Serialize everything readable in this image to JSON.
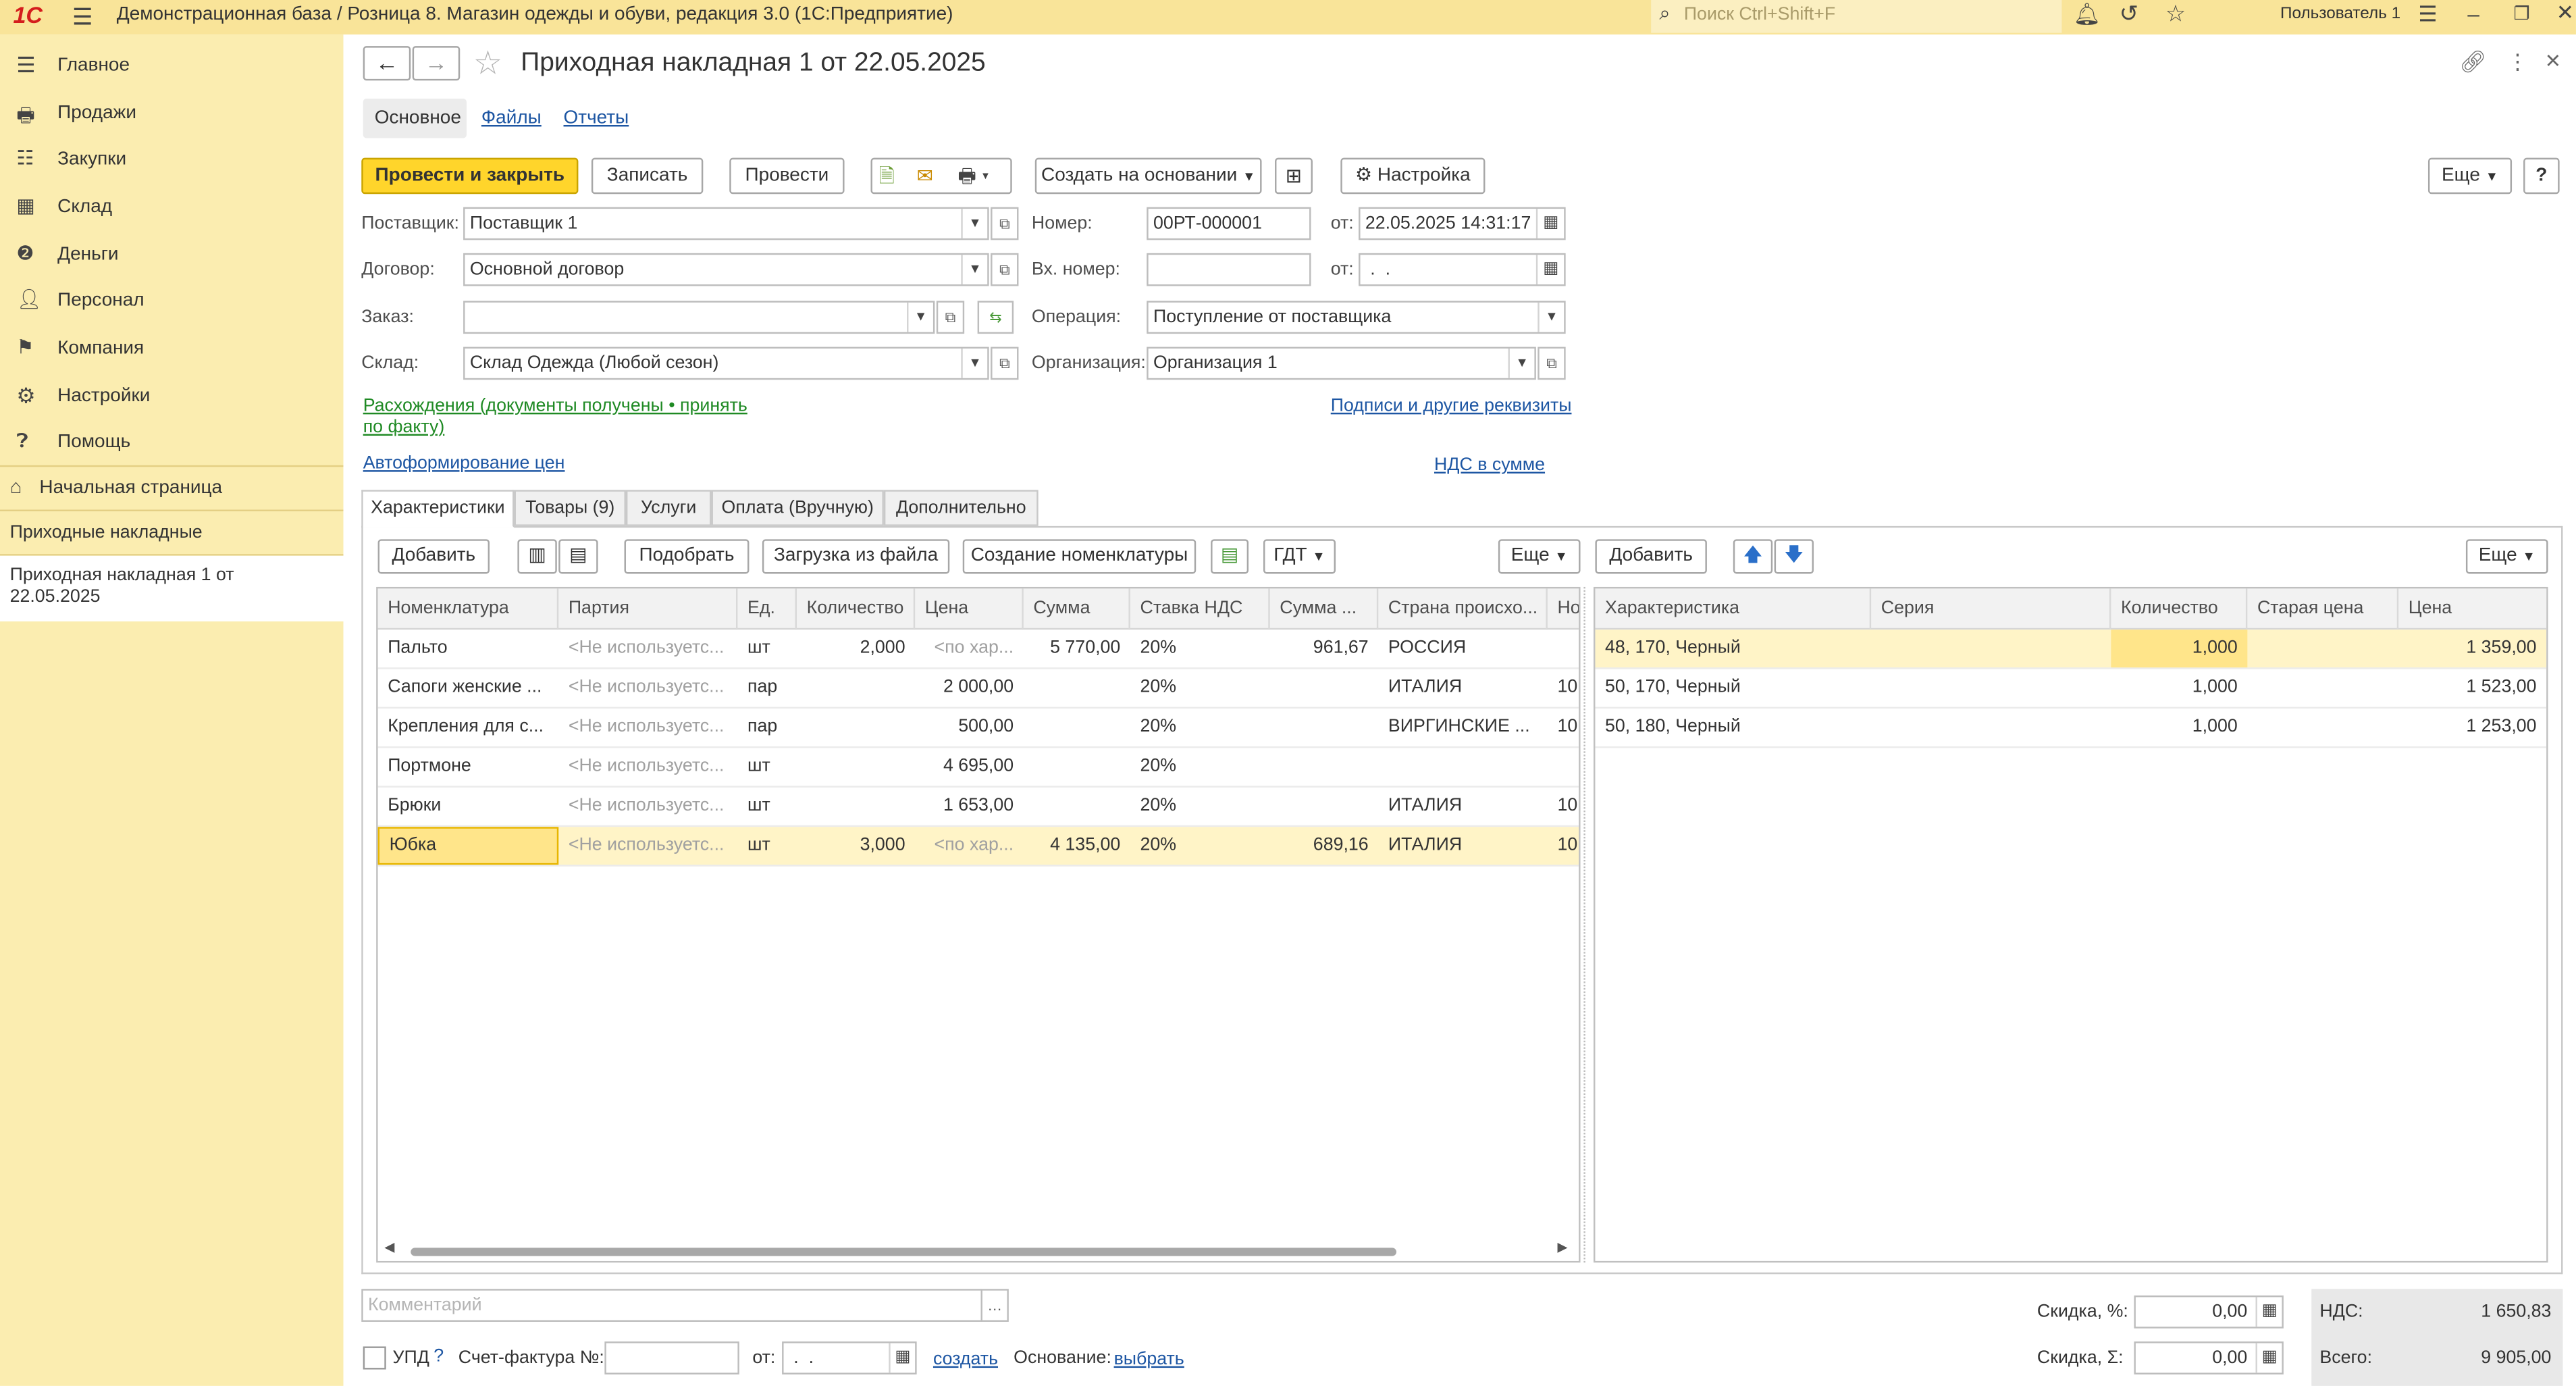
{
  "window": {
    "logo": "1С",
    "title": "Демонстрационная база / Розница 8. Магазин одежды и обуви, редакция 3.0  (1С:Предприятие)",
    "search_placeholder": "Поиск Ctrl+Shift+F",
    "user": "Пользователь 1"
  },
  "sidebar": {
    "items": [
      {
        "label": "Главное",
        "icon": "menu-icon"
      },
      {
        "label": "Продажи",
        "icon": "sales-icon"
      },
      {
        "label": "Закупки",
        "icon": "purchases-icon"
      },
      {
        "label": "Склад",
        "icon": "warehouse-icon"
      },
      {
        "label": "Деньги",
        "icon": "money-icon"
      },
      {
        "label": "Персонал",
        "icon": "personnel-icon"
      },
      {
        "label": "Компания",
        "icon": "company-icon"
      },
      {
        "label": "Настройки",
        "icon": "settings-icon"
      },
      {
        "label": "Помощь",
        "icon": "help-icon"
      }
    ],
    "home": "Начальная страница",
    "open_windows": [
      "Приходные накладные",
      "Приходная накладная 1 от 22.05.2025"
    ]
  },
  "doc": {
    "title": "Приходная накладная 1 от 22.05.2025",
    "nav_tabs": [
      "Основное",
      "Файлы",
      "Отчеты"
    ],
    "toolbar": {
      "post_close": "Провести и закрыть",
      "save": "Записать",
      "post": "Провести",
      "create_based": "Создать на основании",
      "settings": "Настройка",
      "more": "Еще",
      "help": "?"
    },
    "fields": {
      "supplier_label": "Поставщик:",
      "supplier_value": "Поставщик 1",
      "contract_label": "Договор:",
      "contract_value": "Основной договор",
      "order_label": "Заказ:",
      "order_value": "",
      "warehouse_label": "Склад:",
      "warehouse_value": "Склад Одежда (Любой сезон)",
      "number_label": "Номер:",
      "number_value": "00РТ-000001",
      "from_label": "от:",
      "date_value": "22.05.2025 14:31:17",
      "in_number_label": "Вх. номер:",
      "in_number_value": "",
      "in_date_value": " .  .",
      "operation_label": "Операция:",
      "operation_value": "Поступление от поставщика",
      "org_label": "Организация:",
      "org_value": "Организация 1"
    },
    "links": {
      "discrepancy": "Расхождения (документы получены • принять по факту)",
      "autoprice": "Автоформирование цен",
      "signatures": "Подписи и другие реквизиты",
      "vat_included": "НДС в сумме"
    },
    "tabs": [
      "Характеристики",
      "Товары (9)",
      "Услуги",
      "Оплата (Вручную)",
      "Дополнительно"
    ],
    "left_toolbar": {
      "add": "Добавить",
      "pick": "Подобрать",
      "load": "Загрузка из файла",
      "create_nom": "Создание номенклатуры",
      "gdt": "ГДТ",
      "more": "Еще"
    },
    "right_toolbar": {
      "add": "Добавить",
      "more": "Еще"
    },
    "left_table": {
      "headers": [
        "Номенклатура",
        "Партия",
        "Ед.",
        "Количество",
        "Цена",
        "Сумма",
        "Ставка НДС",
        "Сумма ...",
        "Страна происхо...",
        "Но"
      ],
      "rows": [
        [
          "Пальто",
          "<Не используетс...",
          "шт",
          "2,000",
          "<по хар...",
          "5 770,00",
          "20%",
          "961,67",
          "РОССИЯ",
          ""
        ],
        [
          "Сапоги женские ...",
          "<Не используетс...",
          "пар",
          "",
          "2 000,00",
          "",
          "20%",
          "",
          "ИТАЛИЯ",
          "10:"
        ],
        [
          "Крепления для с...",
          "<Не используетс...",
          "пар",
          "",
          "500,00",
          "",
          "20%",
          "",
          "ВИРГИНСКИЕ ...",
          "10:"
        ],
        [
          "Портмоне",
          "<Не используетс...",
          "шт",
          "",
          "4 695,00",
          "",
          "20%",
          "",
          "",
          ""
        ],
        [
          "Брюки",
          "<Не используетс...",
          "шт",
          "",
          "1 653,00",
          "",
          "20%",
          "",
          "ИТАЛИЯ",
          "10:"
        ],
        [
          "Юбка",
          "<Не используетс...",
          "шт",
          "3,000",
          "<по хар...",
          "4 135,00",
          "20%",
          "689,16",
          "ИТАЛИЯ",
          "10:"
        ]
      ]
    },
    "right_table": {
      "headers": [
        "Характеристика",
        "Серия",
        "Количество",
        "Старая цена",
        "Цена"
      ],
      "rows": [
        [
          "48, 170, Черный",
          "",
          "1,000",
          "",
          "1 359,00"
        ],
        [
          "50, 170, Черный",
          "",
          "1,000",
          "",
          "1 523,00"
        ],
        [
          "50, 180, Черный",
          "",
          "1,000",
          "",
          "1 253,00"
        ]
      ]
    },
    "footer": {
      "comment_placeholder": "Комментарий",
      "upd_label": "УПД",
      "invoice_label": "Счет-фактура №:",
      "from_label": "от:",
      "invoice_date": " .  .",
      "create_link": "создать",
      "basis_label": "Основание:",
      "basis_link": "выбрать",
      "discount_pct_label": "Скидка, %:",
      "discount_pct_value": "0,00",
      "discount_sum_label": "Скидка, Σ:",
      "discount_sum_value": "0,00",
      "vat_label": "НДС:",
      "vat_value": "1 650,83",
      "total_label": "Всего:",
      "total_value": "9 905,00"
    }
  }
}
